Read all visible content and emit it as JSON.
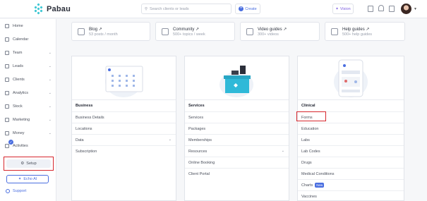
{
  "app": {
    "logo_text": "Pabau"
  },
  "topbar": {
    "search_placeholder": "Search clients or leads",
    "create_label": "Create",
    "vision_label": "Vision"
  },
  "sidebar": {
    "items": [
      {
        "label": "Home",
        "chevron": false
      },
      {
        "label": "Calendar",
        "chevron": false
      },
      {
        "label": "Team",
        "chevron": true
      },
      {
        "label": "Leads",
        "chevron": true
      },
      {
        "label": "Clients",
        "chevron": true
      },
      {
        "label": "Analytics",
        "chevron": true
      },
      {
        "label": "Stock",
        "chevron": true
      },
      {
        "label": "Marketing",
        "chevron": true
      },
      {
        "label": "Money",
        "chevron": true
      },
      {
        "label": "Activities",
        "chevron": false
      }
    ],
    "setup_label": "Setup",
    "echo_label": "Echo AI",
    "support_label": "Support"
  },
  "link_cards": [
    {
      "title": "Blog",
      "sub": "53 posts / month"
    },
    {
      "title": "Community",
      "sub": "500+ topics / week"
    },
    {
      "title": "Video guides",
      "sub": "300+ videos"
    },
    {
      "title": "Help guides",
      "sub": "500+ help guides"
    }
  ],
  "columns": {
    "business": {
      "title": "Business",
      "rows": [
        "Business Details",
        "Locations",
        "Data",
        "Subscription"
      ]
    },
    "services": {
      "title": "Services",
      "rows": [
        "Services",
        "Packages",
        "Memberships",
        "Resources",
        "Online Booking",
        "Client Portal"
      ]
    },
    "clinical": {
      "title": "Clinical",
      "rows": [
        "Forms",
        "Education",
        "Labs",
        "Lab Codes",
        "Drugs",
        "Medical Conditions",
        "Charts",
        "Vaccines"
      ],
      "charts_badge": "New"
    }
  },
  "colors": {
    "accent": "#4a6ee0",
    "brand": "#3cc7d3",
    "highlight": "#d6262d"
  }
}
